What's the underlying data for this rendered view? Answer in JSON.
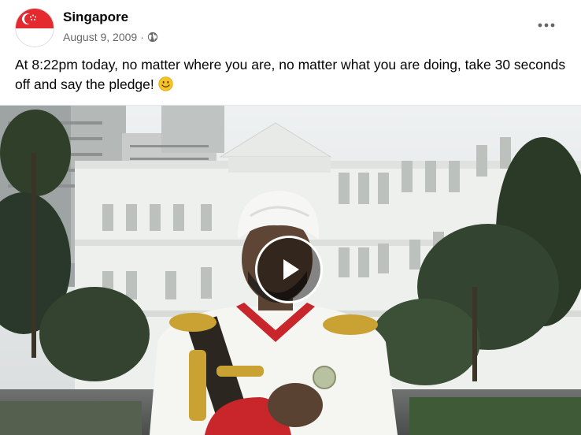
{
  "post": {
    "page_name": "Singapore",
    "date": "August 9, 2009",
    "separator": "·",
    "audience_icon": "globe-icon",
    "text": "At 8:22pm today, no matter where you are, no matter what you are doing, take 30 seconds off and say the pledge!",
    "emoji_icon": "smiling-face-icon"
  },
  "video": {
    "play_icon": "play-icon"
  },
  "colors": {
    "flag_red": "#e4292f",
    "meta_gray": "#65676b",
    "text": "#050505"
  }
}
